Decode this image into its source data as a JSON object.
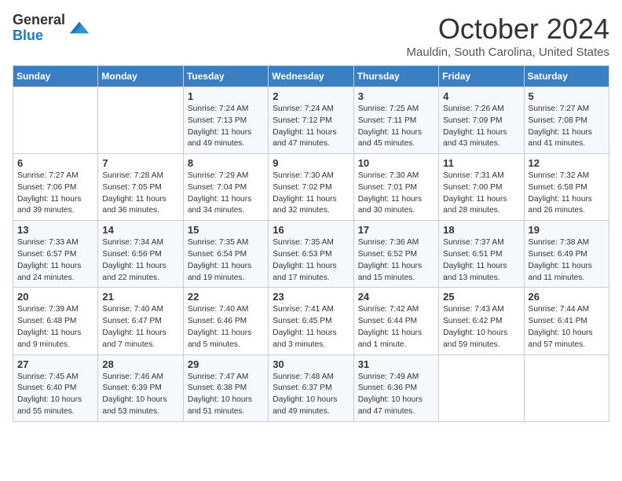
{
  "header": {
    "logo_general": "General",
    "logo_blue": "Blue",
    "month": "October 2024",
    "location": "Mauldin, South Carolina, United States"
  },
  "days_of_week": [
    "Sunday",
    "Monday",
    "Tuesday",
    "Wednesday",
    "Thursday",
    "Friday",
    "Saturday"
  ],
  "weeks": [
    [
      {
        "day": "",
        "sunrise": "",
        "sunset": "",
        "daylight": ""
      },
      {
        "day": "",
        "sunrise": "",
        "sunset": "",
        "daylight": ""
      },
      {
        "day": "1",
        "sunrise": "Sunrise: 7:24 AM",
        "sunset": "Sunset: 7:13 PM",
        "daylight": "Daylight: 11 hours and 49 minutes."
      },
      {
        "day": "2",
        "sunrise": "Sunrise: 7:24 AM",
        "sunset": "Sunset: 7:12 PM",
        "daylight": "Daylight: 11 hours and 47 minutes."
      },
      {
        "day": "3",
        "sunrise": "Sunrise: 7:25 AM",
        "sunset": "Sunset: 7:11 PM",
        "daylight": "Daylight: 11 hours and 45 minutes."
      },
      {
        "day": "4",
        "sunrise": "Sunrise: 7:26 AM",
        "sunset": "Sunset: 7:09 PM",
        "daylight": "Daylight: 11 hours and 43 minutes."
      },
      {
        "day": "5",
        "sunrise": "Sunrise: 7:27 AM",
        "sunset": "Sunset: 7:08 PM",
        "daylight": "Daylight: 11 hours and 41 minutes."
      }
    ],
    [
      {
        "day": "6",
        "sunrise": "Sunrise: 7:27 AM",
        "sunset": "Sunset: 7:06 PM",
        "daylight": "Daylight: 11 hours and 39 minutes."
      },
      {
        "day": "7",
        "sunrise": "Sunrise: 7:28 AM",
        "sunset": "Sunset: 7:05 PM",
        "daylight": "Daylight: 11 hours and 36 minutes."
      },
      {
        "day": "8",
        "sunrise": "Sunrise: 7:29 AM",
        "sunset": "Sunset: 7:04 PM",
        "daylight": "Daylight: 11 hours and 34 minutes."
      },
      {
        "day": "9",
        "sunrise": "Sunrise: 7:30 AM",
        "sunset": "Sunset: 7:02 PM",
        "daylight": "Daylight: 11 hours and 32 minutes."
      },
      {
        "day": "10",
        "sunrise": "Sunrise: 7:30 AM",
        "sunset": "Sunset: 7:01 PM",
        "daylight": "Daylight: 11 hours and 30 minutes."
      },
      {
        "day": "11",
        "sunrise": "Sunrise: 7:31 AM",
        "sunset": "Sunset: 7:00 PM",
        "daylight": "Daylight: 11 hours and 28 minutes."
      },
      {
        "day": "12",
        "sunrise": "Sunrise: 7:32 AM",
        "sunset": "Sunset: 6:58 PM",
        "daylight": "Daylight: 11 hours and 26 minutes."
      }
    ],
    [
      {
        "day": "13",
        "sunrise": "Sunrise: 7:33 AM",
        "sunset": "Sunset: 6:57 PM",
        "daylight": "Daylight: 11 hours and 24 minutes."
      },
      {
        "day": "14",
        "sunrise": "Sunrise: 7:34 AM",
        "sunset": "Sunset: 6:56 PM",
        "daylight": "Daylight: 11 hours and 22 minutes."
      },
      {
        "day": "15",
        "sunrise": "Sunrise: 7:35 AM",
        "sunset": "Sunset: 6:54 PM",
        "daylight": "Daylight: 11 hours and 19 minutes."
      },
      {
        "day": "16",
        "sunrise": "Sunrise: 7:35 AM",
        "sunset": "Sunset: 6:53 PM",
        "daylight": "Daylight: 11 hours and 17 minutes."
      },
      {
        "day": "17",
        "sunrise": "Sunrise: 7:36 AM",
        "sunset": "Sunset: 6:52 PM",
        "daylight": "Daylight: 11 hours and 15 minutes."
      },
      {
        "day": "18",
        "sunrise": "Sunrise: 7:37 AM",
        "sunset": "Sunset: 6:51 PM",
        "daylight": "Daylight: 11 hours and 13 minutes."
      },
      {
        "day": "19",
        "sunrise": "Sunrise: 7:38 AM",
        "sunset": "Sunset: 6:49 PM",
        "daylight": "Daylight: 11 hours and 11 minutes."
      }
    ],
    [
      {
        "day": "20",
        "sunrise": "Sunrise: 7:39 AM",
        "sunset": "Sunset: 6:48 PM",
        "daylight": "Daylight: 11 hours and 9 minutes."
      },
      {
        "day": "21",
        "sunrise": "Sunrise: 7:40 AM",
        "sunset": "Sunset: 6:47 PM",
        "daylight": "Daylight: 11 hours and 7 minutes."
      },
      {
        "day": "22",
        "sunrise": "Sunrise: 7:40 AM",
        "sunset": "Sunset: 6:46 PM",
        "daylight": "Daylight: 11 hours and 5 minutes."
      },
      {
        "day": "23",
        "sunrise": "Sunrise: 7:41 AM",
        "sunset": "Sunset: 6:45 PM",
        "daylight": "Daylight: 11 hours and 3 minutes."
      },
      {
        "day": "24",
        "sunrise": "Sunrise: 7:42 AM",
        "sunset": "Sunset: 6:44 PM",
        "daylight": "Daylight: 11 hours and 1 minute."
      },
      {
        "day": "25",
        "sunrise": "Sunrise: 7:43 AM",
        "sunset": "Sunset: 6:42 PM",
        "daylight": "Daylight: 10 hours and 59 minutes."
      },
      {
        "day": "26",
        "sunrise": "Sunrise: 7:44 AM",
        "sunset": "Sunset: 6:41 PM",
        "daylight": "Daylight: 10 hours and 57 minutes."
      }
    ],
    [
      {
        "day": "27",
        "sunrise": "Sunrise: 7:45 AM",
        "sunset": "Sunset: 6:40 PM",
        "daylight": "Daylight: 10 hours and 55 minutes."
      },
      {
        "day": "28",
        "sunrise": "Sunrise: 7:46 AM",
        "sunset": "Sunset: 6:39 PM",
        "daylight": "Daylight: 10 hours and 53 minutes."
      },
      {
        "day": "29",
        "sunrise": "Sunrise: 7:47 AM",
        "sunset": "Sunset: 6:38 PM",
        "daylight": "Daylight: 10 hours and 51 minutes."
      },
      {
        "day": "30",
        "sunrise": "Sunrise: 7:48 AM",
        "sunset": "Sunset: 6:37 PM",
        "daylight": "Daylight: 10 hours and 49 minutes."
      },
      {
        "day": "31",
        "sunrise": "Sunrise: 7:49 AM",
        "sunset": "Sunset: 6:36 PM",
        "daylight": "Daylight: 10 hours and 47 minutes."
      },
      {
        "day": "",
        "sunrise": "",
        "sunset": "",
        "daylight": ""
      },
      {
        "day": "",
        "sunrise": "",
        "sunset": "",
        "daylight": ""
      }
    ]
  ]
}
